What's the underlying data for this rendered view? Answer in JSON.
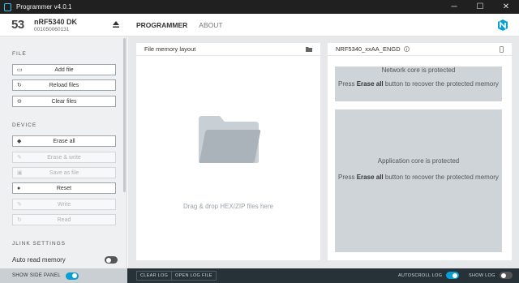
{
  "window": {
    "title": "Programmer v4.0.1",
    "minimize": "─",
    "maximize": "☐",
    "close": "✕"
  },
  "device": {
    "number": "53",
    "name": "nRF5340 DK",
    "serial": "001050060131"
  },
  "nav": {
    "programmer": "PROGRAMMER",
    "about": "ABOUT"
  },
  "sidebar": {
    "file_section": "FILE",
    "device_section": "DEVICE",
    "jlink_section": "JLINK SETTINGS",
    "buttons": {
      "add_file": "Add file",
      "reload_files": "Reload files",
      "clear_files": "Clear files",
      "erase_all": "Erase all",
      "erase_write": "Erase & write",
      "save_as_file": "Save as file",
      "reset": "Reset",
      "write": "Write",
      "read": "Read"
    },
    "auto_read_memory": {
      "label": "Auto read memory",
      "enabled": false
    }
  },
  "file_panel": {
    "title": "File memory layout",
    "drop_message": "Drag & drop HEX/ZIP files here"
  },
  "device_panel": {
    "title": "NRF5340_xxAA_ENGD",
    "network_core": {
      "title": "Network core is protected",
      "msg_pre": "Press ",
      "msg_bold": "Erase all",
      "msg_post": " button to recover the protected memory"
    },
    "application_core": {
      "title": "Application core is protected",
      "msg_pre": "Press ",
      "msg_bold": "Erase all",
      "msg_post": " button to recover the protected memory"
    }
  },
  "footer": {
    "show_side_panel": {
      "label": "SHOW SIDE PANEL",
      "enabled": true
    },
    "clear_log": "CLEAR LOG",
    "open_log_file": "OPEN LOG FILE",
    "autoscroll_log": {
      "label": "AUTOSCROLL LOG",
      "enabled": true
    },
    "show_log": {
      "label": "SHOW LOG",
      "enabled": false
    }
  },
  "colors": {
    "accent": "#0a9fd4",
    "footer": "#263238",
    "core_bg": "#ced4d8"
  }
}
